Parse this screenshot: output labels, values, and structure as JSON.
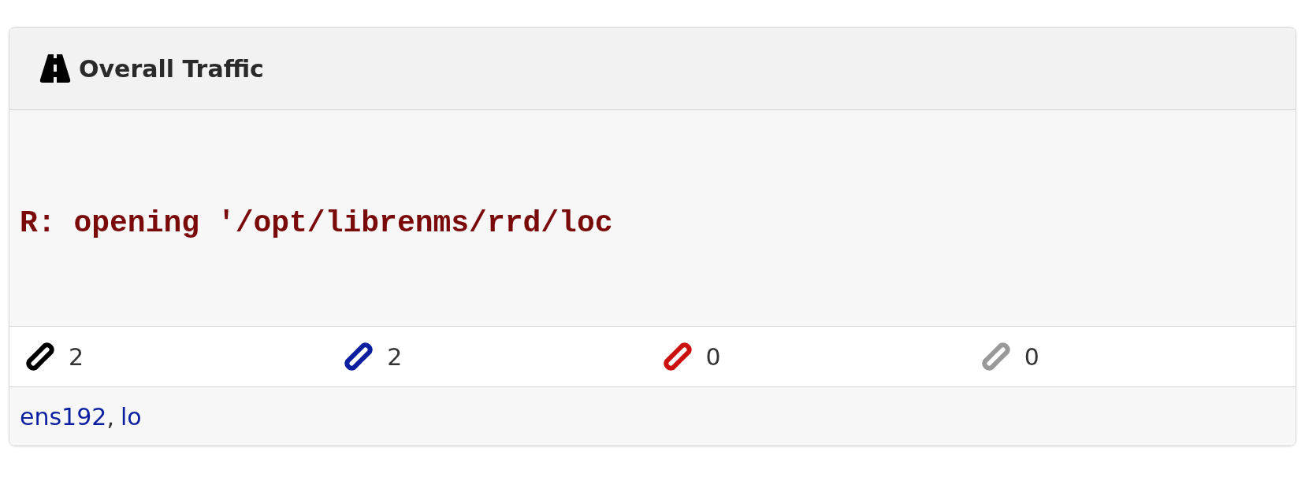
{
  "panel": {
    "title": "Overall Traffic"
  },
  "graph": {
    "error_text": "R: opening '/opt/librenms/rrd/loc"
  },
  "stats": [
    {
      "count": "2",
      "color": "#000000"
    },
    {
      "count": "2",
      "color": "#0a1fa0"
    },
    {
      "count": "0",
      "color": "#cc1111"
    },
    {
      "count": "0",
      "color": "#999999"
    }
  ],
  "links": [
    {
      "label": "ens192"
    },
    {
      "label": "lo"
    }
  ],
  "link_separator": ","
}
